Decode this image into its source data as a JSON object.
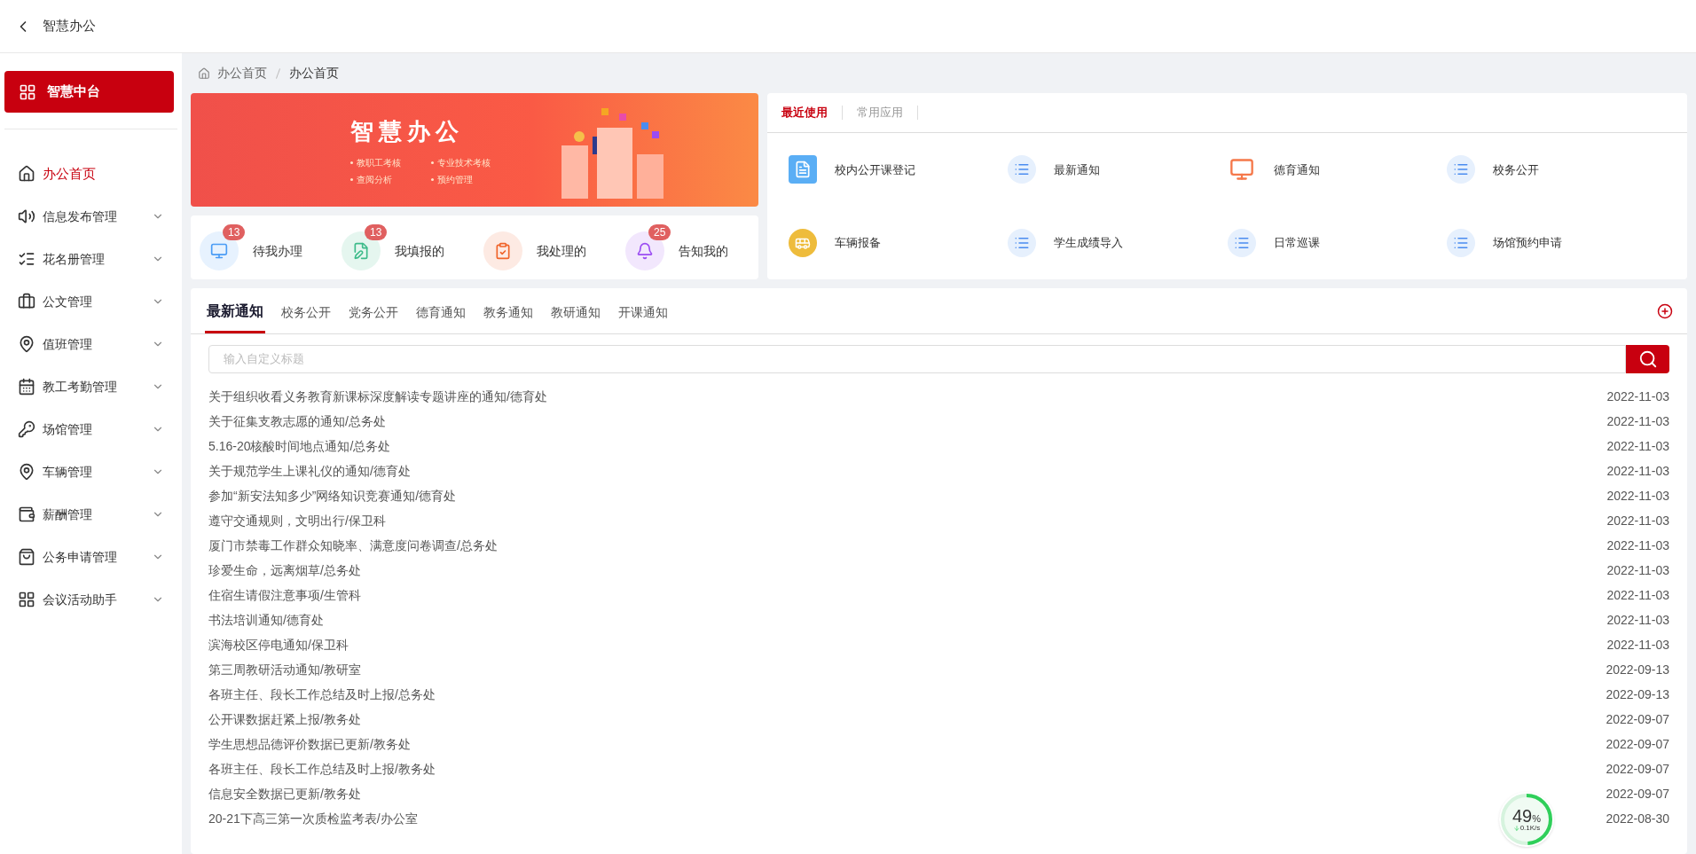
{
  "header": {
    "title": "智慧办公"
  },
  "sidebar": {
    "platform_button": "智慧中台",
    "items": [
      {
        "label": "办公首页",
        "selected": true,
        "expandable": false
      },
      {
        "label": "信息发布管理",
        "selected": false,
        "expandable": true
      },
      {
        "label": "花名册管理",
        "selected": false,
        "expandable": true
      },
      {
        "label": "公文管理",
        "selected": false,
        "expandable": true
      },
      {
        "label": "值班管理",
        "selected": false,
        "expandable": true
      },
      {
        "label": "教工考勤管理",
        "selected": false,
        "expandable": true
      },
      {
        "label": "场馆管理",
        "selected": false,
        "expandable": true
      },
      {
        "label": "车辆管理",
        "selected": false,
        "expandable": true
      },
      {
        "label": "薪酬管理",
        "selected": false,
        "expandable": true
      },
      {
        "label": "公务申请管理",
        "selected": false,
        "expandable": true
      },
      {
        "label": "会议活动助手",
        "selected": false,
        "expandable": true
      }
    ]
  },
  "breadcrumb": [
    "办公首页",
    "办公首页"
  ],
  "banner": {
    "title": "智慧办公",
    "bullets": [
      "教职工考核",
      "专业技术考核",
      "查阅分析",
      "预约管理"
    ]
  },
  "quick_actions": [
    {
      "label": "待我办理",
      "badge": "13",
      "color": "#4a9cf5"
    },
    {
      "label": "我填报的",
      "badge": "13",
      "color": "#3dbb8a"
    },
    {
      "label": "我处理的",
      "color": "#f0642a"
    },
    {
      "label": "告知我的",
      "badge": "25",
      "color": "#9b4cf2"
    }
  ],
  "apps": {
    "tabs": [
      {
        "label": "最近使用",
        "selected": true
      },
      {
        "label": "常用应用",
        "selected": false
      }
    ],
    "items": [
      {
        "label": "校内公开课登记",
        "kind": "document"
      },
      {
        "label": "最新通知",
        "kind": "list"
      },
      {
        "label": "德育通知",
        "kind": "monitor"
      },
      {
        "label": "校务公开",
        "kind": "list"
      },
      {
        "label": "车辆报备",
        "kind": "vehicle"
      },
      {
        "label": "学生成绩导入",
        "kind": "list"
      },
      {
        "label": "日常巡课",
        "kind": "list"
      },
      {
        "label": "场馆预约申请",
        "kind": "list"
      }
    ]
  },
  "notices": {
    "tabs": [
      {
        "label": "最新通知",
        "selected": true
      },
      {
        "label": "校务公开",
        "selected": false
      },
      {
        "label": "党务公开",
        "selected": false
      },
      {
        "label": "德育通知",
        "selected": false
      },
      {
        "label": "教务通知",
        "selected": false
      },
      {
        "label": "教研通知",
        "selected": false
      },
      {
        "label": "开课通知",
        "selected": false
      }
    ],
    "search": {
      "placeholder": "输入自定义标题"
    },
    "rows": [
      {
        "title": "关于组织收看义务教育新课标深度解读专题讲座的通知/德育处",
        "date": "2022-11-03"
      },
      {
        "title": "关于征集支教志愿的通知/总务处",
        "date": "2022-11-03"
      },
      {
        "title": "5.16-20核酸时间地点通知/总务处",
        "date": "2022-11-03"
      },
      {
        "title": "关于规范学生上课礼仪的通知/德育处",
        "date": "2022-11-03"
      },
      {
        "title": "参加“新安法知多少”网络知识竞赛通知/德育处",
        "date": "2022-11-03"
      },
      {
        "title": "遵守交通规则，文明出行/保卫科",
        "date": "2022-11-03"
      },
      {
        "title": "厦门市禁毒工作群众知晓率、满意度问卷调查/总务处",
        "date": "2022-11-03"
      },
      {
        "title": "珍爱生命，远离烟草/总务处",
        "date": "2022-11-03"
      },
      {
        "title": "住宿生请假注意事项/生管科",
        "date": "2022-11-03"
      },
      {
        "title": "书法培训通知/德育处",
        "date": "2022-11-03"
      },
      {
        "title": "滨海校区停电通知/保卫科",
        "date": "2022-11-03"
      },
      {
        "title": "第三周教研活动通知/教研室",
        "date": "2022-09-13"
      },
      {
        "title": "各班主任、段长工作总结及时上报/总务处",
        "date": "2022-09-13"
      },
      {
        "title": "公开课数据赶紧上报/教务处",
        "date": "2022-09-07"
      },
      {
        "title": "学生思想品德评价数据已更新/教务处",
        "date": "2022-09-07"
      },
      {
        "title": "各班主任、段长工作总结及时上报/教务处",
        "date": "2022-09-07"
      },
      {
        "title": "信息安全数据已更新/教务处",
        "date": "2022-09-07"
      },
      {
        "title": "20-21下高三第一次质检监考表/办公室",
        "date": "2022-08-30"
      }
    ]
  },
  "network_widget": {
    "percent": "49",
    "unit": "%",
    "speed": "0.1K/s",
    "level": 0.49
  }
}
